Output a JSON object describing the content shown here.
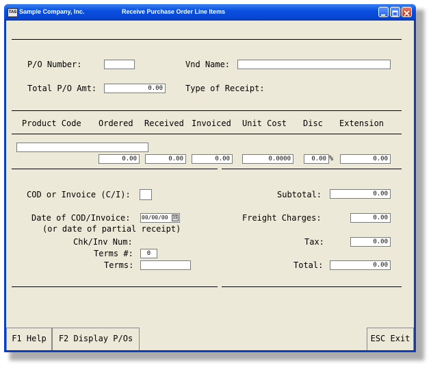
{
  "window": {
    "app_icon_label": "TAS",
    "company": "Sample Company, Inc.",
    "title": "Receive Purchase Order Line Items"
  },
  "header": {
    "po_number_label": "P/O Number:",
    "po_number_value": "",
    "total_po_amt_label": "Total P/O Amt:",
    "total_po_amt_value": "0.00",
    "vnd_name_label": "Vnd Name:",
    "vnd_name_value": "",
    "type_of_receipt_label": "Type of Receipt:"
  },
  "columns": [
    "Product Code",
    "Ordered",
    "Received",
    "Invoiced",
    "Unit Cost",
    "Disc",
    "Extension"
  ],
  "line": {
    "product_code": "",
    "ordered": "0.00",
    "received": "0.00",
    "invoiced": "0.00",
    "unit_cost": "0.0000",
    "disc": "0.00",
    "disc_symbol": "%",
    "extension": "0.00"
  },
  "footer": {
    "cod_label": "COD or Invoice (C/I):",
    "cod_value": "",
    "date_label": "Date of COD/Invoice:",
    "date_value": "00/00/00",
    "date_sub_label": "(or date of partial receipt)",
    "chk_label": "Chk/Inv Num:",
    "terms_num_label": "Terms #:",
    "terms_num_value": "0",
    "terms_label": "Terms:",
    "terms_value": "",
    "subtotal_label": "Subtotal:",
    "subtotal_value": "0.00",
    "freight_label": "Freight Charges:",
    "freight_value": "0.00",
    "tax_label": "Tax:",
    "tax_value": "0.00",
    "total_label": "Total:",
    "total_value": "0.00"
  },
  "fkeys": {
    "f1": "F1 Help",
    "f2": "F2 Display P/Os",
    "esc": "ESC Exit"
  }
}
